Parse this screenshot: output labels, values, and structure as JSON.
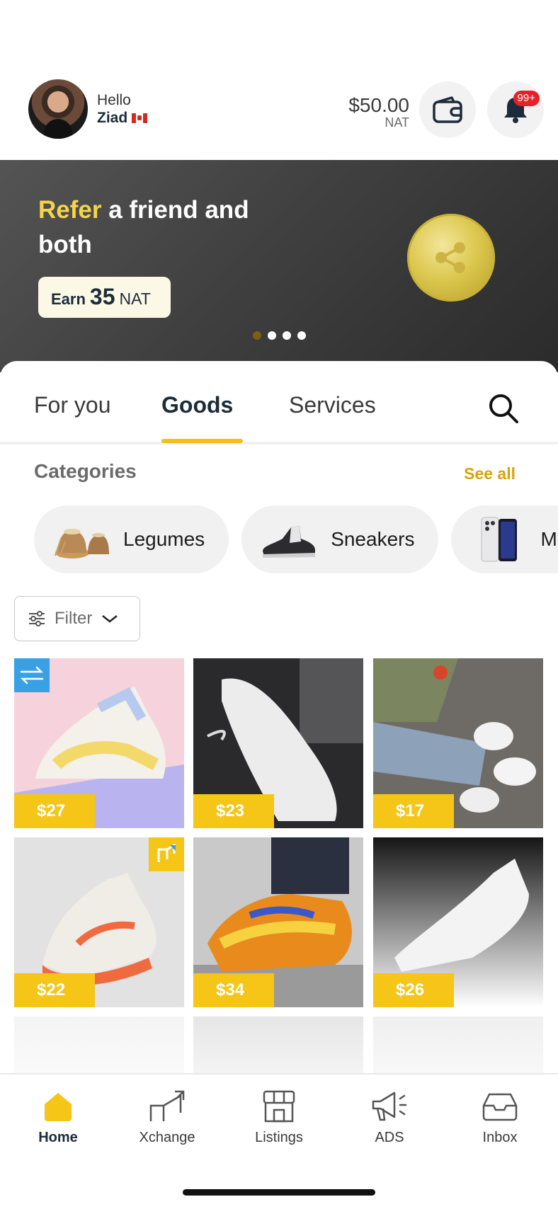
{
  "header": {
    "greeting": "Hello",
    "user_name": "Ziad",
    "balance_amount": "$50.00",
    "balance_currency": "NAT",
    "notification_badge": "99+"
  },
  "banner": {
    "highlight": "Refer",
    "title_rest": " a friend and both",
    "earn_label": "Earn",
    "earn_amount": "35",
    "earn_currency": "NAT",
    "slide_count": 4,
    "active_slide": 1
  },
  "tabs": [
    {
      "label": "For you",
      "active": false
    },
    {
      "label": "Goods",
      "active": true
    },
    {
      "label": "Services",
      "active": false
    }
  ],
  "categories": {
    "heading": "Categories",
    "see_all": "See all",
    "items": [
      {
        "label": "Legumes",
        "icon": "sack-icon"
      },
      {
        "label": "Sneakers",
        "icon": "sneaker-icon"
      },
      {
        "label": "Mo",
        "icon": "phone-icon"
      }
    ]
  },
  "filter": {
    "label": "Filter"
  },
  "products": [
    {
      "price": "$27",
      "badge": "exchange-icon",
      "bg": "#f6d3dc",
      "accent": "#b9b3f0"
    },
    {
      "price": "$23",
      "badge": "",
      "bg": "#2a2a2c",
      "accent": "#e9e9e9"
    },
    {
      "price": "$17",
      "badge": "",
      "bg": "#6e6b66",
      "accent": "#8da2b8"
    },
    {
      "price": "$22",
      "badge": "listing-icon",
      "bg": "#e2e2e2",
      "accent": "#f06a40"
    },
    {
      "price": "$34",
      "badge": "",
      "bg": "#c9c9c9",
      "accent": "#e98b1c"
    },
    {
      "price": "$26",
      "badge": "",
      "bg": "#1d1d1d",
      "accent": "#f1f1f1"
    }
  ],
  "nav": [
    {
      "label": "Home",
      "icon": "home-icon",
      "active": true
    },
    {
      "label": "Xchange",
      "icon": "exchange-icon",
      "active": false
    },
    {
      "label": "Listings",
      "icon": "store-icon",
      "active": false
    },
    {
      "label": "ADS",
      "icon": "megaphone-icon",
      "active": false
    },
    {
      "label": "Inbox",
      "icon": "inbox-icon",
      "active": false
    }
  ],
  "colors": {
    "accent": "#f5c518",
    "badge_red": "#e8202a",
    "text_dark": "#1c2c3a"
  }
}
